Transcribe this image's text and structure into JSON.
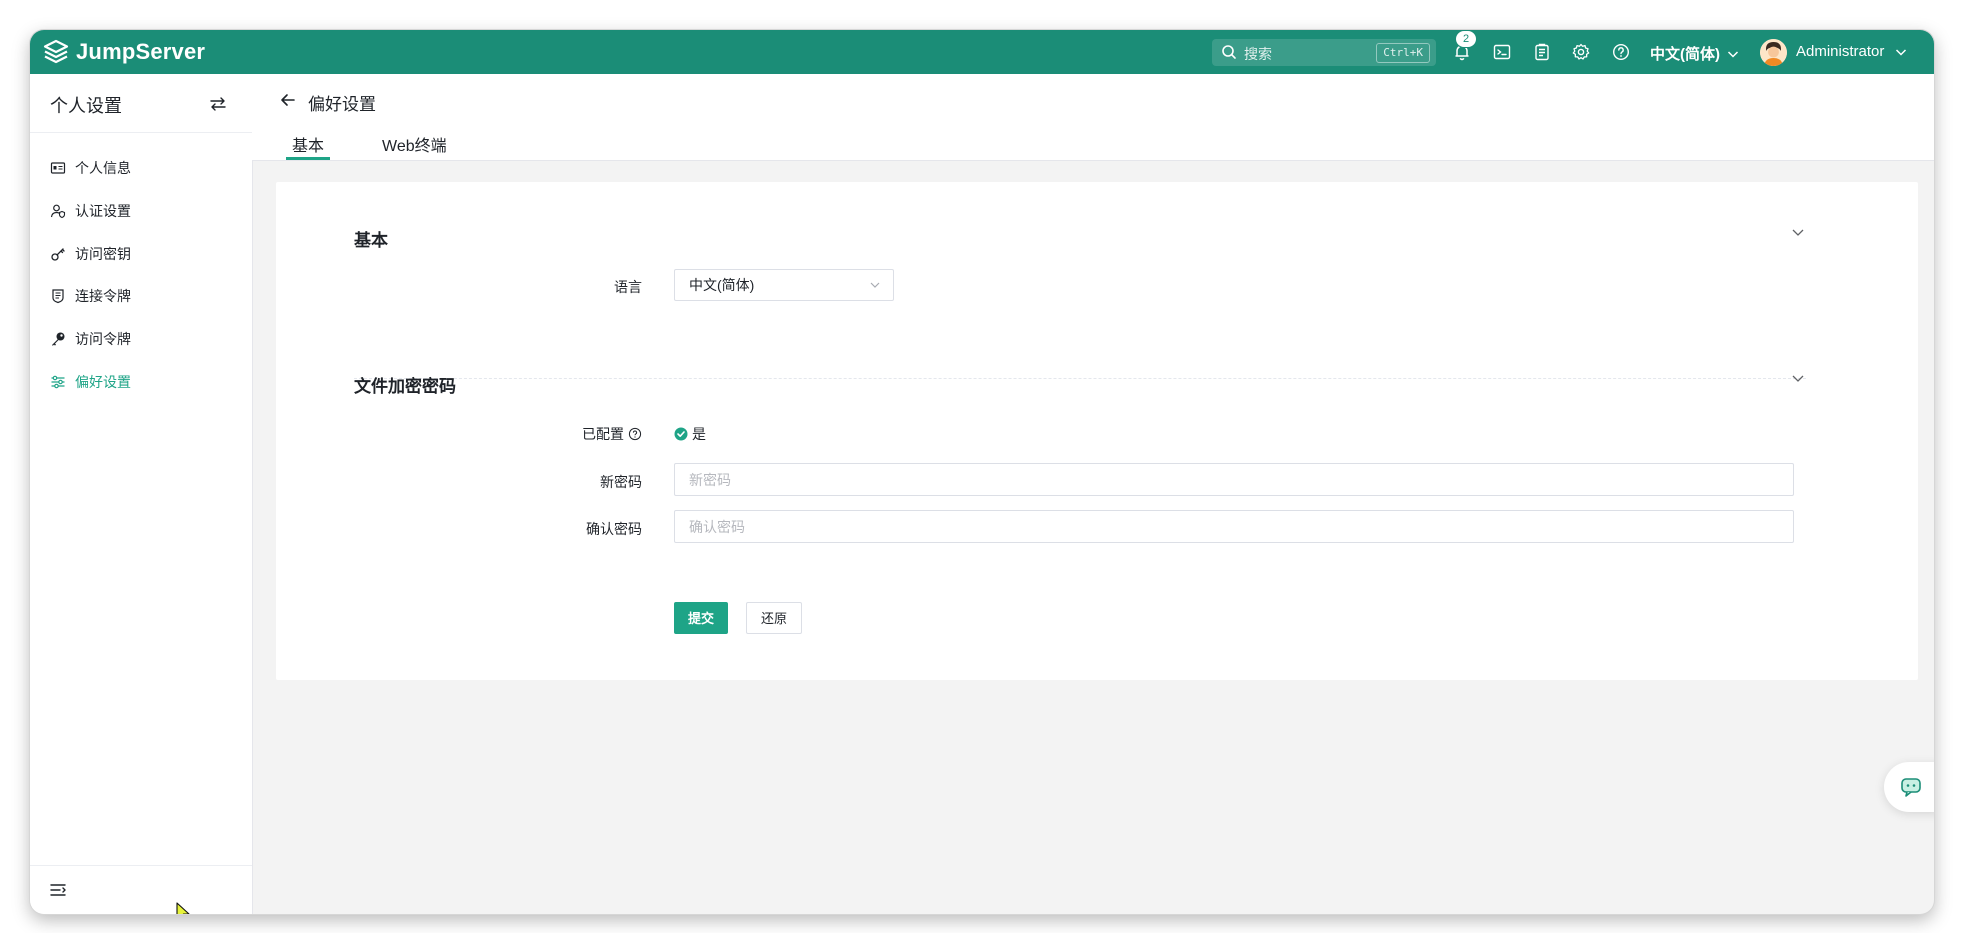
{
  "brand": {
    "name": "JumpServer",
    "color": "#1b8d77",
    "accent": "#1ea487"
  },
  "topbar": {
    "search_placeholder": "搜索",
    "search_shortcut": "Ctrl+K",
    "notification_count": "2",
    "icons": [
      "bell-icon",
      "terminal-icon",
      "clipboard-icon",
      "gear-icon",
      "help-icon"
    ],
    "language": "中文(简体)",
    "user": "Administrator"
  },
  "sidebar": {
    "title": "个人设置",
    "items": [
      {
        "label": "个人信息",
        "icon": "id-card-icon",
        "active": false
      },
      {
        "label": "认证设置",
        "icon": "user-shield-icon",
        "active": false
      },
      {
        "label": "访问密钥",
        "icon": "key-outline-icon",
        "active": false
      },
      {
        "label": "连接令牌",
        "icon": "token-badge-icon",
        "active": false
      },
      {
        "label": "访问令牌",
        "icon": "key-solid-icon",
        "active": false
      },
      {
        "label": "偏好设置",
        "icon": "sliders-icon",
        "active": true
      }
    ]
  },
  "header": {
    "title": "偏好设置",
    "tabs": [
      {
        "label": "基本",
        "active": true
      },
      {
        "label": "Web终端",
        "active": false
      }
    ]
  },
  "form": {
    "basic": {
      "title": "基本",
      "language_label": "语言",
      "language_value": "中文(简体)"
    },
    "file_encryption": {
      "title": "文件加密密码",
      "configured_label": "已配置",
      "configured_value": "是",
      "new_password_label": "新密码",
      "new_password_placeholder": "新密码",
      "confirm_password_label": "确认密码",
      "confirm_password_placeholder": "确认密码"
    },
    "submit_label": "提交",
    "reset_label": "还原"
  }
}
